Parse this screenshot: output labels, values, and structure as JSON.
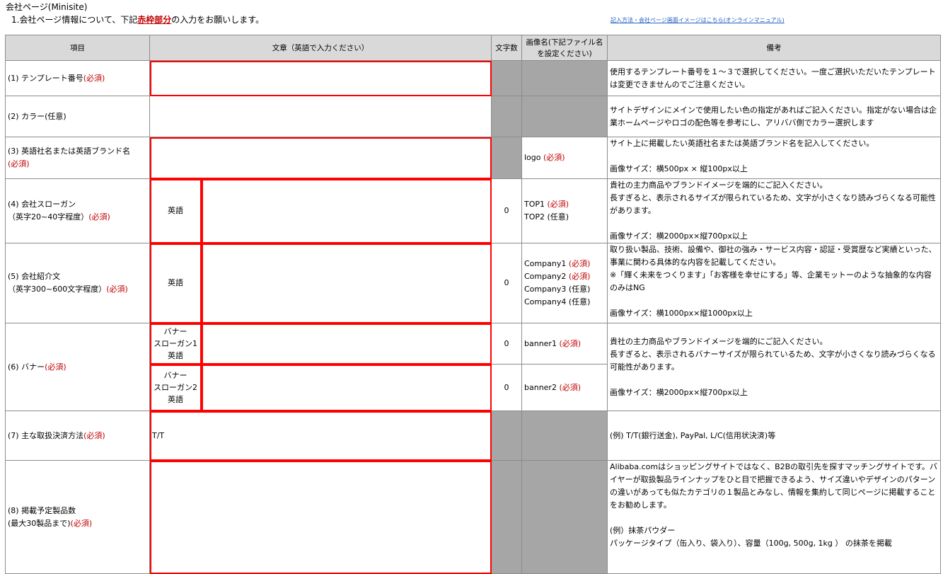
{
  "header": {
    "sheet_title": "会社ページ(Minisite)",
    "instruction_prefix": "1.会社ページ情報について、下記",
    "instruction_strong": "赤枠部分",
    "instruction_suffix": "の入力をお願いします。",
    "manual_link": "記入方法・会社ページ画面イメージはこちら(オンラインマニュアル)"
  },
  "columns": {
    "item": "項目",
    "text": "文章（英語で入力ください）",
    "char_count": "文字数",
    "image_name": "画像名(下記ファイル名を設定ください)",
    "remarks": "備考"
  },
  "required_mark": "(必須)",
  "rows": {
    "template": {
      "label": "(1) テンプレート番号",
      "value": "",
      "remarks": "使用するテンプレート番号を１～３で選択してください。一度ご選択いただいたテンプレートは変更できませんのでご注意ください。"
    },
    "color": {
      "label": "(2) カラー(任意)",
      "value": "",
      "remarks": "サイトデザインにメインで使用したい色の指定があればご記入ください。指定がない場合は企業ホームページやロゴの配色等を参考にし、アリババ側でカラー選択します"
    },
    "brand": {
      "label": "(3) 英語社名または英語ブランド名",
      "value": "",
      "image_name": "logo ",
      "remarks_1": "サイト上に掲載したい英語社名または英語ブランド名を記入してください。",
      "remarks_2": "画像サイズ：横500px × 縦100px以上"
    },
    "slogan": {
      "label_1": "(4) 会社スローガン",
      "label_2": "（英字20~40字程度）",
      "lang": "英語",
      "value": "",
      "char_count": "0",
      "image_1": "TOP1 ",
      "image_2": "TOP2 (任意)",
      "remarks_1": "貴社の主力商品やブランドイメージを端的にご記入ください。",
      "remarks_2": "長すぎると、表示されるサイズが限られているため、文字が小さくなり読みづらくなる可能性があります。",
      "remarks_3": "画像サイズ：横2000px×縦700px以上"
    },
    "intro": {
      "label_1": "(5) 会社紹介文",
      "label_2": "（英字300~600文字程度）",
      "lang": "英語",
      "value": "",
      "char_count": "0",
      "image_1": "Company1 ",
      "image_2": "Company2 ",
      "image_3": "Company3 (任意)",
      "image_4": "Company4 (任意)",
      "remarks_1": "取り扱い製品、技術、設備や、御社の強み・サービス内容・認証・受賞歴など実績といった、事業に関わる具体的な内容を記載してください。",
      "remarks_2": "※「輝く未来をつくります」「お客様を幸せにする」等、企業モットーのような抽象的な内容のみはNG",
      "remarks_3": "画像サイズ：横1000px×縦1000px以上"
    },
    "banner": {
      "label": "(6) バナー",
      "sub_1": "バナー\nスローガン1\n英語",
      "sub_2": "バナー\nスローガン2\n英語",
      "value_1": "",
      "value_2": "",
      "char_count_1": "0",
      "char_count_2": "0",
      "image_1": "banner1 ",
      "image_2": "banner2 ",
      "remarks_1": "貴社の主力商品やブランドイメージを端的にご記入ください。",
      "remarks_2": "長すぎると、表示されるバナーサイズが限られているため、文字が小さくなり読みづらくなる可能性があります。",
      "remarks_3": "画像サイズ：横2000px×縦700px以上"
    },
    "payment": {
      "label": "(7) 主な取扱決済方法",
      "value": "T/T",
      "remarks": "(例) T/T(銀行送金), PayPal, L/C(信用状決済)等"
    },
    "products": {
      "label_1": "(8) 掲載予定製品数",
      "label_2": "(最大30製品まで)",
      "value": "",
      "remarks_1": "Alibaba.comはショッピングサイトではなく、B2Bの取引先を探すマッチングサイトです。バイヤーが取扱製品ラインナップをひと目で把握できるよう、サイズ違いやデザインのパターンの違いがあっても似たカテゴリの１製品とみなし、情報を集約して同じページに掲載することをお勧めします。",
      "remarks_2": "(例）抹茶パウダー",
      "remarks_3": "パッケージタイプ（缶入り、袋入り）、容量（100g, 500g, 1kg ） の抹茶を掲載"
    }
  }
}
